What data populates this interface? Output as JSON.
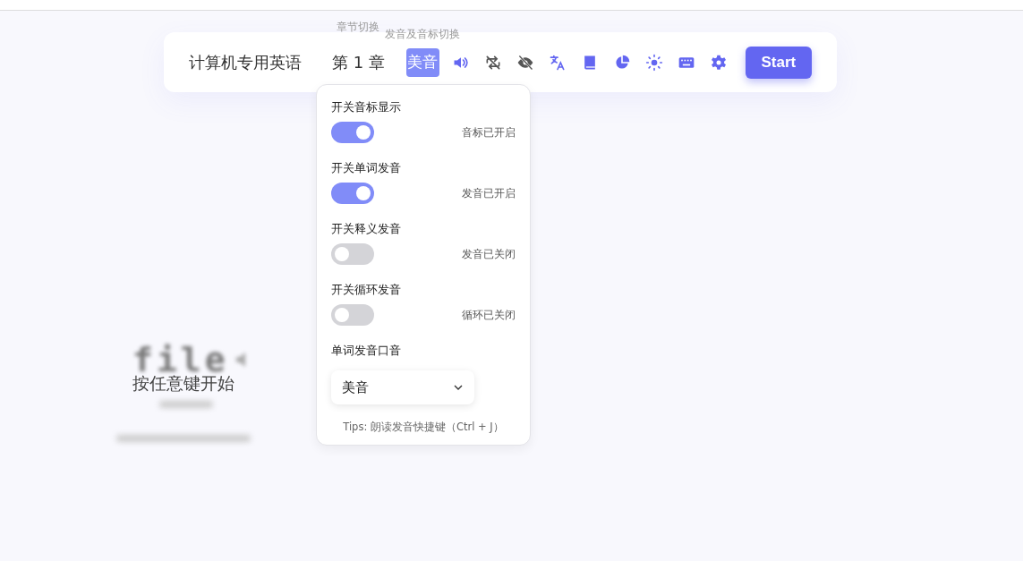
{
  "tooltips": [
    "章节切换",
    "发音及音标切换"
  ],
  "toolbar": {
    "dictionary": "计算机专用英语",
    "chapter": "第 1 章",
    "accent_button": {
      "label": "美音",
      "selected": true
    },
    "start_button": "Start"
  },
  "settings_popup": {
    "toggles": [
      {
        "label": "开关音标显示",
        "on": true,
        "status": "音标已开启"
      },
      {
        "label": "开关单词发音",
        "on": true,
        "status": "发音已开启"
      },
      {
        "label": "开关释义发音",
        "on": false,
        "status": "发音已关闭"
      },
      {
        "label": "开关循环发音",
        "on": false,
        "status": "循环已关闭"
      }
    ],
    "accent": {
      "label": "单词发音口音",
      "value": "美音"
    },
    "tips": "Tips: 朗读发音快捷键（Ctrl + J）"
  },
  "background": {
    "word": "file",
    "prompt": "按任意键开始"
  }
}
